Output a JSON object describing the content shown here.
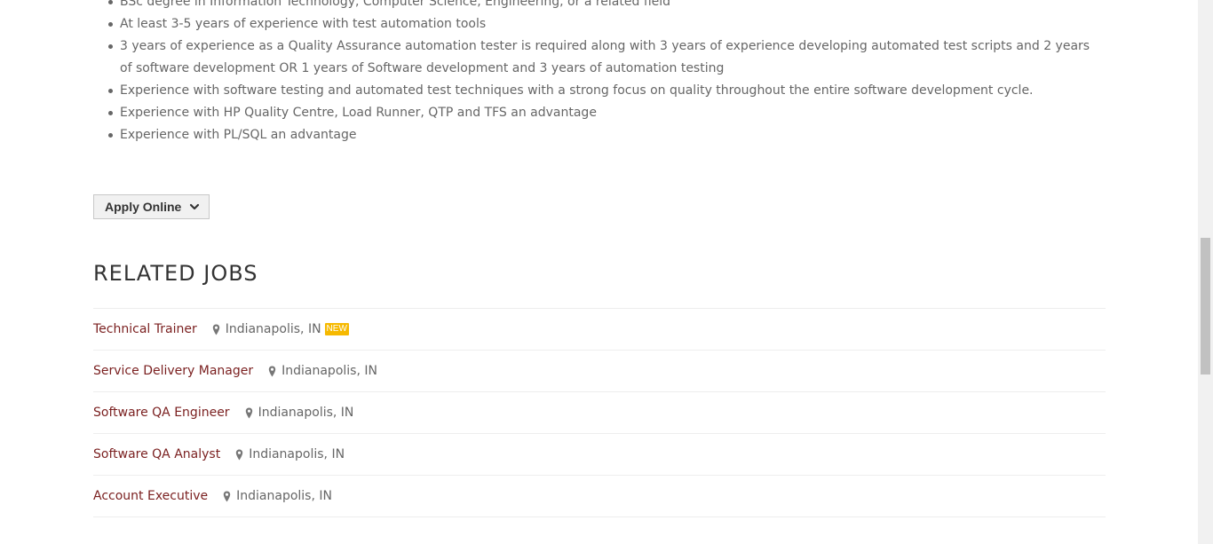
{
  "requirements": [
    "BSc degree in Information Technology, Computer Science, Engineering, or a related field",
    "At least 3-5 years of experience with test automation tools",
    "3 years of experience as a Quality Assurance automation tester is required along with 3 years of experience developing automated test scripts and 2 years of software development OR 1 years of Software development and 3 years of automation testing",
    "Experience with software testing and automated test techniques with a strong focus on quality throughout the entire software development cycle.",
    "Experience with HP Quality Centre, Load Runner, QTP and TFS an advantage",
    "Experience with PL/SQL an advantage"
  ],
  "apply": {
    "label": "Apply Online",
    "icon": "chevron-down-icon"
  },
  "related": {
    "title": "RELATED JOBS",
    "jobs": [
      {
        "title": "Technical Trainer",
        "location": "Indianapolis, IN",
        "badge": "NEW"
      },
      {
        "title": "Service Delivery Manager",
        "location": "Indianapolis, IN"
      },
      {
        "title": "Software QA Engineer",
        "location": "Indianapolis, IN"
      },
      {
        "title": "Software QA Analyst",
        "location": "Indianapolis, IN"
      },
      {
        "title": "Account Executive",
        "location": "Indianapolis, IN"
      }
    ]
  },
  "colors": {
    "link": "#7a1f1f",
    "badge": "#f6b900",
    "text": "#666666"
  }
}
